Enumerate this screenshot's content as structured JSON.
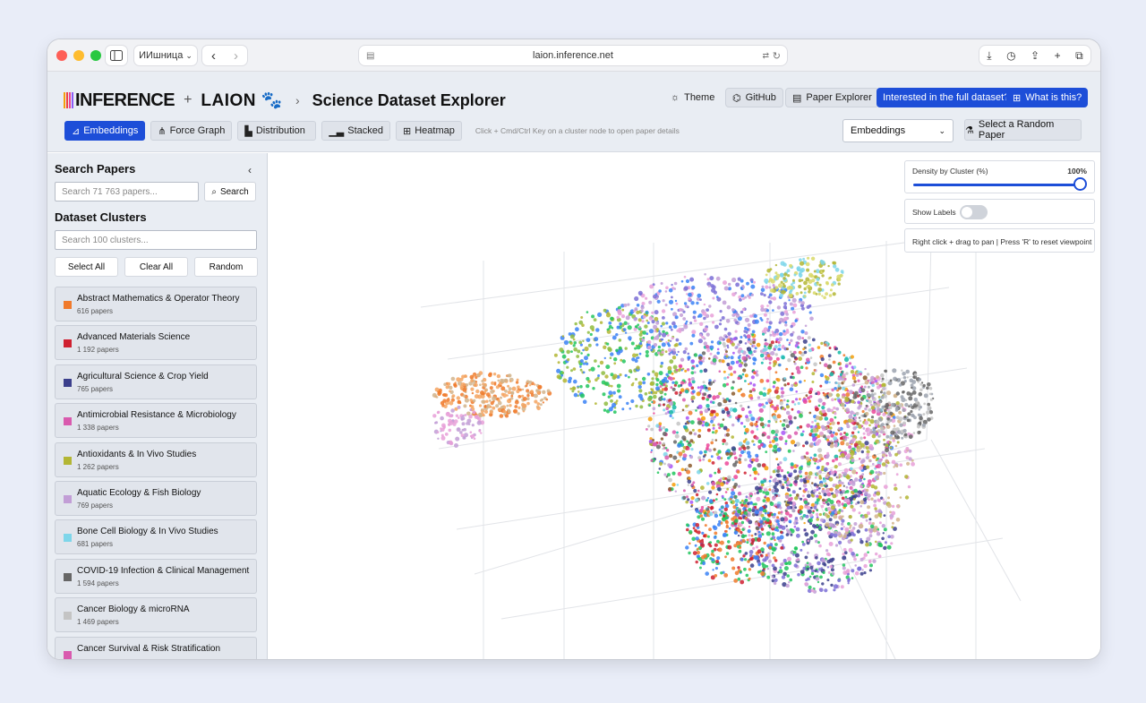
{
  "browser": {
    "profile_label": "ИИшница",
    "url": "laion.inference.net"
  },
  "brand": {
    "inference": "INFERENCE",
    "plus": "+",
    "laion": "LAION",
    "separator": "›",
    "title": "Science Dataset Explorer"
  },
  "header_buttons": {
    "theme": "Theme",
    "github": "GitHub",
    "paper_explorer": "Paper Explorer",
    "full_dataset": "Interested in the full dataset?",
    "what_is_this": "What is this?"
  },
  "tabs": [
    {
      "label": "Embeddings",
      "active": true
    },
    {
      "label": "Force Graph",
      "active": false
    },
    {
      "label": "Distribution",
      "active": false
    },
    {
      "label": "Stacked",
      "active": false
    },
    {
      "label": "Heatmap",
      "active": false
    }
  ],
  "hint": "Click + Cmd/Ctrl Key on a cluster node to open paper details",
  "view_select": "Embeddings",
  "random_paper": "Select a Random Paper",
  "sidebar": {
    "search_title": "Search Papers",
    "search_placeholder": "Search 71 763 papers...",
    "search_button": "Search",
    "clusters_title": "Dataset Clusters",
    "cluster_search_placeholder": "Search 100 clusters...",
    "select_all": "Select All",
    "clear_all": "Clear All",
    "random": "Random",
    "clusters": [
      {
        "name": "Abstract Mathematics & Operator Theory",
        "count": "616 papers",
        "color": "#f07a2b"
      },
      {
        "name": "Advanced Materials Science",
        "count": "1 192 papers",
        "color": "#cf2030"
      },
      {
        "name": "Agricultural Science & Crop Yield",
        "count": "765 papers",
        "color": "#3b3f8c"
      },
      {
        "name": "Antimicrobial Resistance & Microbiology",
        "count": "1 338 papers",
        "color": "#d95aae"
      },
      {
        "name": "Antioxidants & In Vivo Studies",
        "count": "1 262 papers",
        "color": "#b3b634"
      },
      {
        "name": "Aquatic Ecology & Fish Biology",
        "count": "769 papers",
        "color": "#c29ed6"
      },
      {
        "name": "Bone Cell Biology & In Vivo Studies",
        "count": "681 papers",
        "color": "#7ed6ea"
      },
      {
        "name": "COVID-19 Infection & Clinical Management",
        "count": "1 594 papers",
        "color": "#666666"
      },
      {
        "name": "Cancer Biology & microRNA",
        "count": "1 469 papers",
        "color": "#c4c4c4"
      },
      {
        "name": "Cancer Survival & Risk Stratification",
        "count": "",
        "color": "#d95aae"
      }
    ]
  },
  "controls": {
    "density_label": "Density by Cluster (%)",
    "density_value": "100%",
    "density_fraction": 1.0,
    "show_labels": "Show Labels",
    "labels_on": false,
    "nav_hint": "Right click + drag to pan | Press 'R' to reset viewpoint"
  }
}
